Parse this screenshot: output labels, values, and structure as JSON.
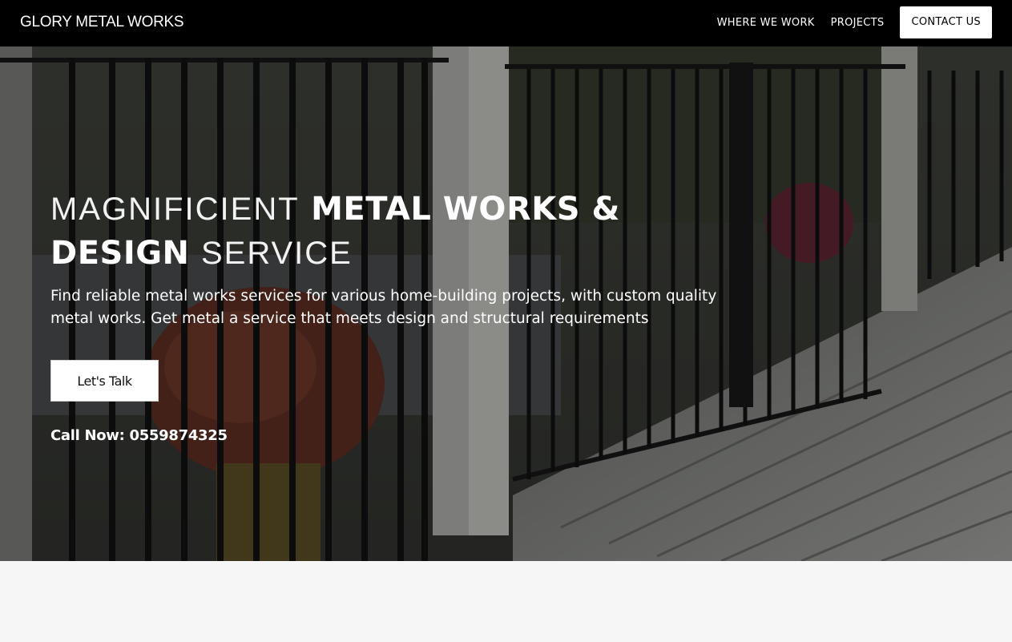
{
  "nav": {
    "brand": "GLORY METAL WORKS",
    "links": [
      {
        "label": "WHERE WE WORK"
      },
      {
        "label": "PROJECTS"
      }
    ],
    "cta_label": "CONTACT US"
  },
  "hero": {
    "headline_line1_thin": "MAGNIFICIENT",
    "headline_line1_bold": "METAL WORKS &",
    "headline_line2_bold": "DESIGN",
    "headline_line2_thin": "SERVICE",
    "subtext": "Find reliable metal works services for various home-building projects, with custom quality metal works. Get metal a service that meets design and structural requirements",
    "button_label": "Let's Talk",
    "call_now": "Call Now: 0559874325"
  },
  "colors": {
    "navbar": "#000000",
    "page_background": "#f6f6f6",
    "button_background": "#ffffff"
  }
}
